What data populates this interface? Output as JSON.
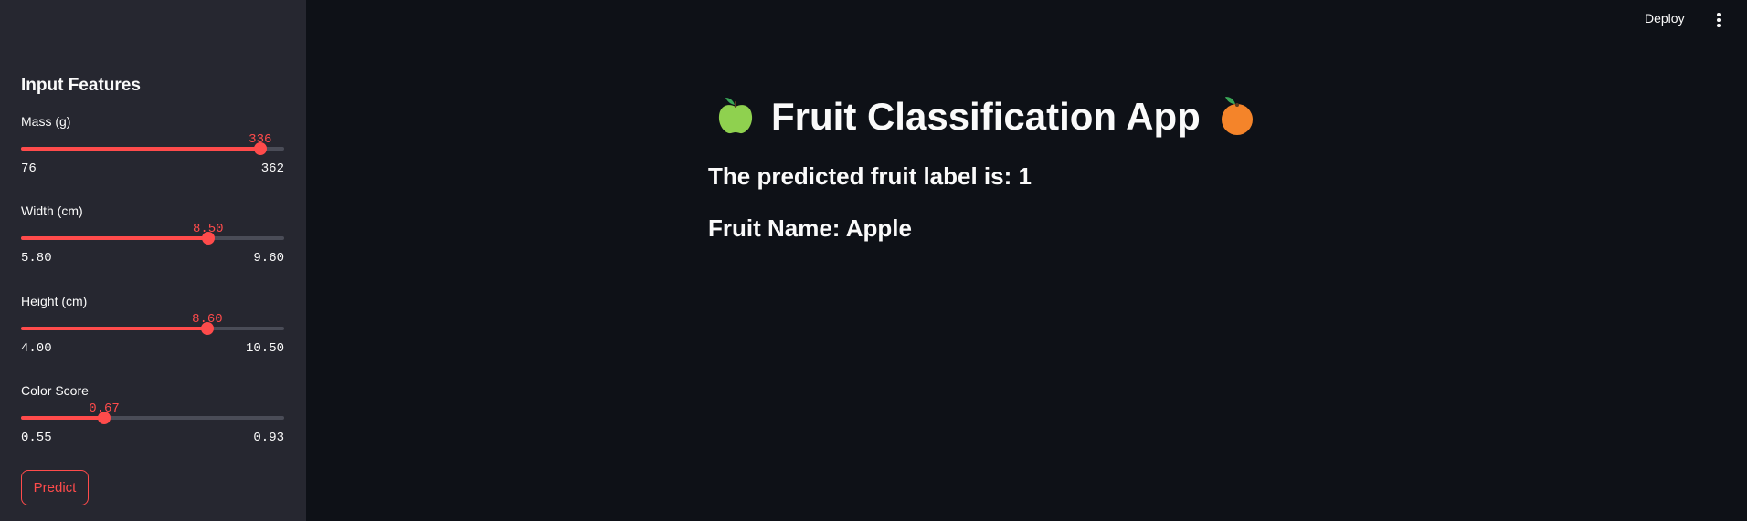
{
  "sidebar": {
    "title": "Input Features",
    "sliders": [
      {
        "label": "Mass (g)",
        "value": "336",
        "min": "76",
        "max": "362",
        "fraction": 0.909
      },
      {
        "label": "Width (cm)",
        "value": "8.50",
        "min": "5.80",
        "max": "9.60",
        "fraction": 0.711
      },
      {
        "label": "Height (cm)",
        "value": "8.60",
        "min": "4.00",
        "max": "10.50",
        "fraction": 0.708
      },
      {
        "label": "Color Score",
        "value": "0.67",
        "min": "0.55",
        "max": "0.93",
        "fraction": 0.316
      }
    ],
    "predict_label": "Predict"
  },
  "header": {
    "deploy_label": "Deploy",
    "menu_icon": "vertical-ellipsis-icon"
  },
  "main": {
    "title": "Fruit Classification App",
    "title_icons": [
      "green-apple-icon",
      "tangerine-icon"
    ],
    "prediction": "The predicted fruit label is: 1",
    "fruit_name": "Fruit Name: Apple"
  },
  "colors": {
    "background": "#0e1117",
    "sidebar": "#262730",
    "accent": "#ff4b4b",
    "text": "#fafafa"
  }
}
